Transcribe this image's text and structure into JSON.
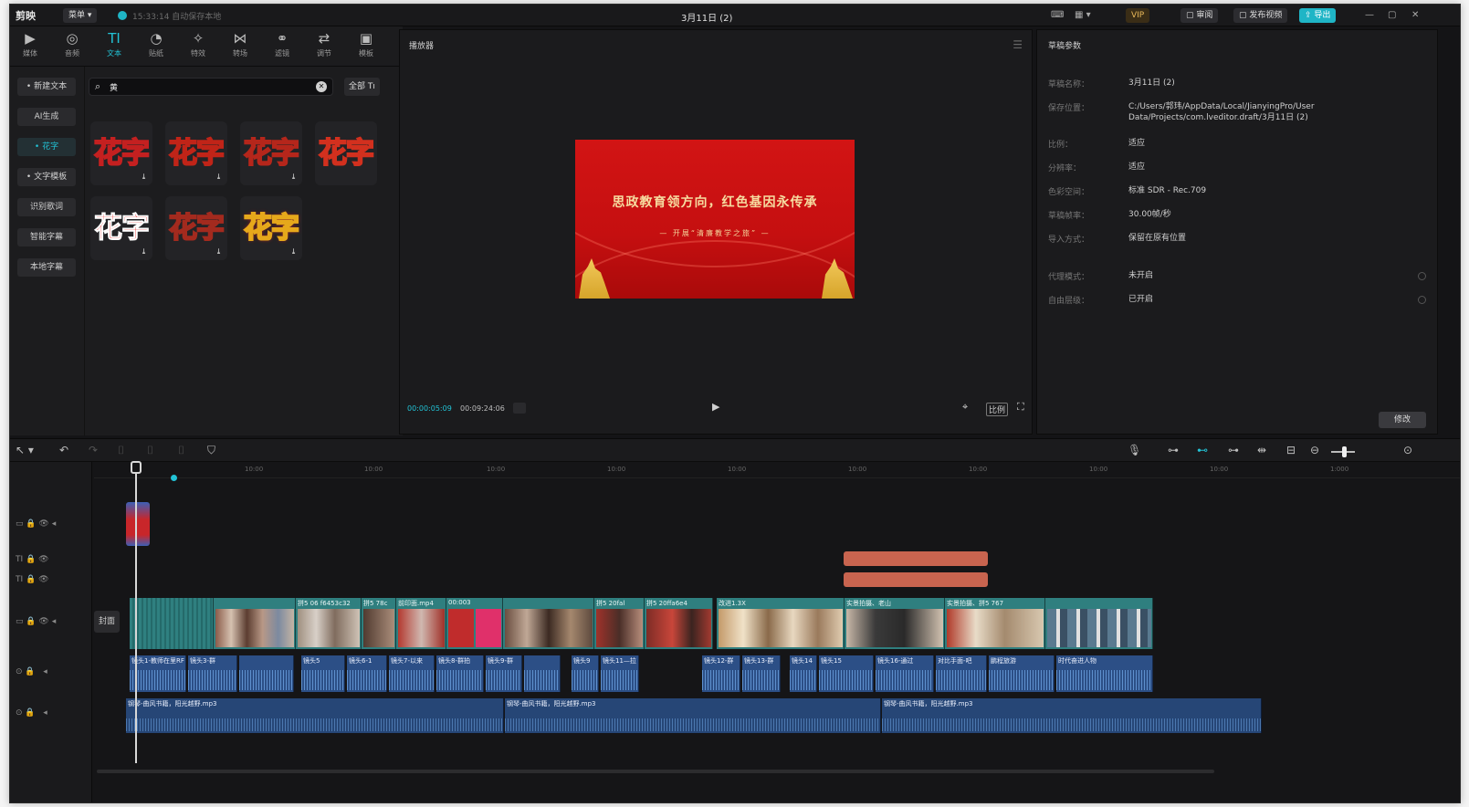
{
  "app": {
    "logo": "剪映",
    "menu": "菜单",
    "autosave": "15:33:14 自动保存本地",
    "project_title": "3月11日 (2)",
    "buttons": {
      "vip": "VIP",
      "review": "审阅",
      "publish": "发布视频",
      "export": "导出"
    }
  },
  "colors": {
    "accent": "#22c3d6",
    "video_track": "#2f7f7f",
    "audio_track": "#2c4f86",
    "text_clip": "#c8644f",
    "banner_red": "#cc1111"
  },
  "tool_tabs": [
    {
      "icon": "media-icon",
      "label": "媒体"
    },
    {
      "icon": "audio-icon",
      "label": "音频"
    },
    {
      "icon": "text-icon",
      "label": "文本"
    },
    {
      "icon": "sticker-icon",
      "label": "贴纸"
    },
    {
      "icon": "effects-icon",
      "label": "特效"
    },
    {
      "icon": "transition-icon",
      "label": "转场"
    },
    {
      "icon": "filter-icon",
      "label": "滤镜"
    },
    {
      "icon": "adjust-icon",
      "label": "调节"
    },
    {
      "icon": "template-icon",
      "label": "模板"
    }
  ],
  "text_panel": {
    "nav": [
      "• 新建文本",
      "AI生成",
      "• 花字",
      "• 文字模板",
      "识别歌词",
      "智能字幕",
      "本地字幕"
    ],
    "search_value": "黄",
    "filter_label": "全部",
    "styles": [
      {
        "text": "花字",
        "colors": [
          "#f7c300",
          "#c42020"
        ]
      },
      {
        "text": "花字",
        "colors": [
          "#ffd54a",
          "#c02418"
        ]
      },
      {
        "text": "花字",
        "colors": [
          "#e8c94c",
          "#b5261b"
        ]
      },
      {
        "text": "花字",
        "colors": [
          "#ffe06a",
          "#d2301e"
        ]
      },
      {
        "text": "花字",
        "colors": [
          "#e01818",
          "#ffffff"
        ]
      },
      {
        "text": "花字",
        "colors": [
          "#fbeed0",
          "#a32a1e"
        ]
      },
      {
        "text": "花字",
        "colors": [
          "#ffffff",
          "#e6a81b"
        ]
      }
    ]
  },
  "player": {
    "header": "播放器",
    "current_time": "00:00:05:09",
    "total_time": "00:09:24:06",
    "ratio_label": "比例",
    "video": {
      "headline": "思政教育领方向，红色基因永传承",
      "subline": "— 开展“清廉教学之旅” —"
    }
  },
  "properties": {
    "header": "草稿参数",
    "modify_label": "修改",
    "rows": [
      {
        "label": "草稿名称：",
        "value": "3月11日 (2)"
      },
      {
        "label": "保存位置：",
        "value": "C:/Users/郭玮/AppData/Local/JianyingPro/User Data/Projects/com.lveditor.draft/3月11日 (2)"
      },
      {
        "label": "比例：",
        "value": "适应"
      },
      {
        "label": "分辨率：",
        "value": "适应"
      },
      {
        "label": "色彩空间：",
        "value": "标准 SDR - Rec.709"
      },
      {
        "label": "草稿帧率：",
        "value": "30.00帧/秒"
      },
      {
        "label": "导入方式：",
        "value": "保留在原有位置"
      },
      {
        "label": "代理模式：",
        "value": "未开启"
      },
      {
        "label": "自由层级：",
        "value": "已开启"
      }
    ]
  },
  "timeline": {
    "ruler": [
      "00:00",
      "10:00",
      "10:00",
      "10:00",
      "10:00",
      "10:00",
      "10:00",
      "10:00",
      "10:00",
      "10:00",
      "1:000"
    ],
    "cover_label": "封面",
    "video_labels": [
      "拼5 06 f6453c32",
      "拼5 78c",
      "前印面.mp4",
      "00:003",
      "拼5 20fal",
      "拼5 20ffa6e4",
      "改进1.3X",
      "实景拍摄、老山",
      "实景拍摄、拼5 767"
    ],
    "audio_labels": [
      "镜头1-教师在里RF",
      "镜头3-群",
      "镜头5",
      "镜头6-1",
      "镜头7-以来",
      "镜头8-群拍",
      "镜头9-群",
      "镜头9",
      "镜头11—拉",
      "镜头12-群",
      "镜头13-群",
      "镜头14",
      "镜头15",
      "镜头16-通过",
      "对比手面-吧",
      "鹏程旅游",
      "时代奋进人物"
    ],
    "music_labels": [
      "钢琴-曲风书籍，阳光越野.mp3",
      "钢琴-曲风书籍，阳光越野.mp3",
      "钢琴-曲风书籍，阳光越野.mp3"
    ]
  }
}
